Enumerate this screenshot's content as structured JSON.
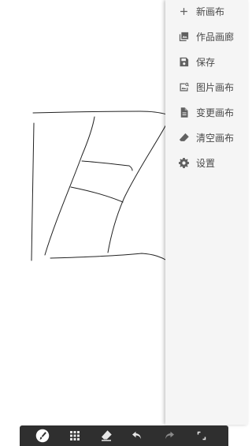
{
  "menu": {
    "items": [
      {
        "icon": "plus-icon",
        "label": "新画布"
      },
      {
        "icon": "gallery-icon",
        "label": "作品画廊"
      },
      {
        "icon": "save-icon",
        "label": "保存"
      },
      {
        "icon": "image-canvas-icon",
        "label": "图片画布"
      },
      {
        "icon": "file-icon",
        "label": "变更画布"
      },
      {
        "icon": "eraser-icon",
        "label": "清空画布"
      },
      {
        "icon": "gear-icon",
        "label": "设置"
      }
    ]
  },
  "toolbar": {
    "tools": [
      {
        "icon": "brush-icon",
        "active": true
      },
      {
        "icon": "grid-icon",
        "active": false
      },
      {
        "icon": "eraser-icon",
        "active": false
      },
      {
        "icon": "undo-icon",
        "active": false
      },
      {
        "icon": "redo-icon",
        "active": false,
        "disabled": true
      },
      {
        "icon": "fullscreen-icon",
        "active": false
      }
    ]
  },
  "colors": {
    "toolbar_bg": "#2f2f2f",
    "panel_bg": "#f5f5f5",
    "icon_gray": "#616161",
    "stroke": "#222222"
  }
}
